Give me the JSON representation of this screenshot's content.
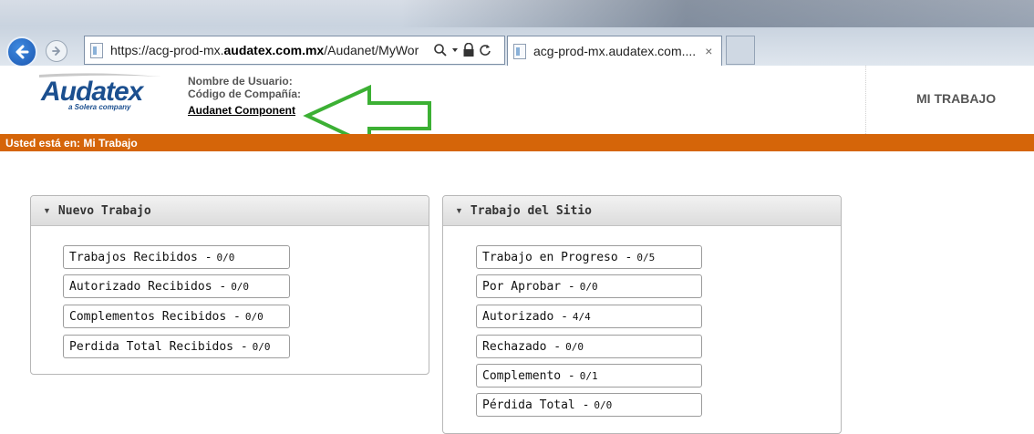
{
  "browser": {
    "url_prefix": "https://acg-prod-mx.",
    "url_domain": "audatex.com.mx",
    "url_path": "/Audanet/MyWor",
    "tab_title": "acg-prod-mx.audatex.com....",
    "tab_close": "×",
    "search_icon": "search-icon",
    "lock_icon": "lock-icon",
    "refresh_icon": "refresh-icon"
  },
  "header": {
    "logo_text": "Audatex",
    "logo_tagline": "a Solera company",
    "username_label": "Nombre de Usuario:",
    "company_code_label": "Código de Compañía:",
    "component_link": "Audanet Component",
    "nav_my_work": "MI TRABAJO"
  },
  "breadcrumb": {
    "text": "Usted está en: Mi Trabajo"
  },
  "panels": {
    "new_work": {
      "title": "Nuevo Trabajo",
      "items": [
        {
          "label": "Trabajos Recibidos -",
          "count": "0/0"
        },
        {
          "label": "Autorizado Recibidos -",
          "count": "0/0"
        },
        {
          "label": "Complementos Recibidos -",
          "count": "0/0"
        },
        {
          "label": "Perdida Total Recibidos -",
          "count": "0/0"
        }
      ]
    },
    "site_work": {
      "title": "Trabajo del Sitio",
      "items": [
        {
          "label": "Trabajo en Progreso -",
          "count": "0/5"
        },
        {
          "label": "Por Aprobar -",
          "count": "0/0"
        },
        {
          "label": "Autorizado -",
          "count": "4/4"
        },
        {
          "label": "Rechazado -",
          "count": "0/0"
        },
        {
          "label": "Complemento -",
          "count": "0/1"
        },
        {
          "label": "Pérdida Total -",
          "count": "0/0"
        }
      ]
    }
  },
  "colors": {
    "accent_orange": "#d56509",
    "annotation_arrow": "#3cb034",
    "logo_blue": "#1b4f8f"
  }
}
